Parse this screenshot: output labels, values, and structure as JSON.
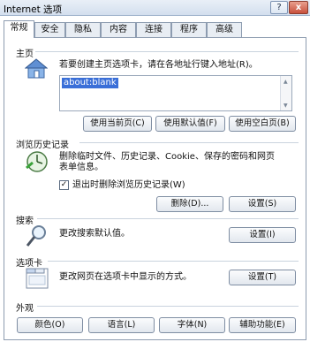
{
  "window": {
    "title": "Internet 选项",
    "help": "?",
    "close": "x"
  },
  "tabs": [
    {
      "label": "常规"
    },
    {
      "label": "安全"
    },
    {
      "label": "隐私"
    },
    {
      "label": "内容"
    },
    {
      "label": "连接"
    },
    {
      "label": "程序"
    },
    {
      "label": "高级"
    }
  ],
  "home": {
    "section": "主页",
    "instruction": "若要创建主页选项卡，请在各地址行键入地址(R)。",
    "value": "about:blank",
    "buttons": {
      "current": "使用当前页(C)",
      "default": "使用默认值(F)",
      "blank": "使用空白页(B)"
    }
  },
  "history": {
    "section": "浏览历史记录",
    "desc1": "删除临时文件、历史记录、Cookie、保存的密码和网页",
    "desc2": "表单信息。",
    "checkbox": "退出时删除浏览历史记录(W)",
    "checked": true,
    "delete": "删除(D)...",
    "settings": "设置(S)"
  },
  "search": {
    "section": "搜索",
    "desc": "更改搜索默认值。",
    "settings": "设置(I)"
  },
  "tabsgroup": {
    "section": "选项卡",
    "desc": "更改网页在选项卡中显示的方式。",
    "settings": "设置(T)"
  },
  "appearance": {
    "section": "外观",
    "colors": "颜色(O)",
    "languages": "语言(L)",
    "fonts": "字体(N)",
    "accessibility": "辅助功能(E)"
  }
}
